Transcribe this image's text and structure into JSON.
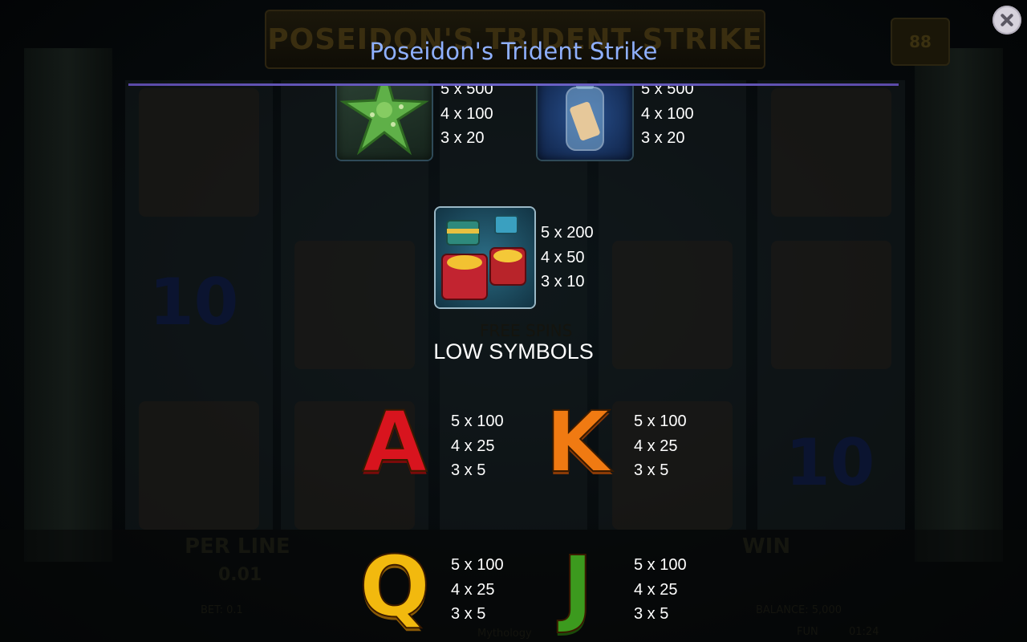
{
  "background": {
    "game_title": "POSEIDON'S TRIDENT STRIKE",
    "badge": "88",
    "per_line_label": "PER LINE",
    "per_line_value": "0.01",
    "win_label": "WIN",
    "bet_text": "BET: 0.1",
    "balance_text": "BALANCE: 5,000",
    "fun_label": "FUN",
    "clock": "01:24",
    "free_spins_text": "FREE SPINS",
    "ten_symbol": "10",
    "footer_brand": "Mythology"
  },
  "paytable": {
    "title": "Poseidon's Trident Strike",
    "close_icon": "close-icon",
    "high_symbols": [
      {
        "icon": "starfish-icon",
        "payouts": [
          "5 x 500",
          "4 x 100",
          "3 x 20"
        ]
      },
      {
        "icon": "message-bottle-icon",
        "payouts": [
          "5 x 500",
          "4 x 100",
          "3 x 20"
        ]
      },
      {
        "icon": "treasure-chests-icon",
        "payouts": [
          "5 x 200",
          "4 x 50",
          "3 x 10"
        ]
      }
    ],
    "low_heading": "LOW SYMBOLS",
    "low_symbols": [
      {
        "letter": "A",
        "color": "#d8141e",
        "payouts": [
          "5 x 100",
          "4 x 25",
          "3 x 5"
        ]
      },
      {
        "letter": "K",
        "color": "#f07a12",
        "payouts": [
          "5 x 100",
          "4 x 25",
          "3 x 5"
        ]
      },
      {
        "letter": "Q",
        "color": "#f2b90e",
        "payouts": [
          "5 x 100",
          "4 x 25",
          "3 x 5"
        ]
      },
      {
        "letter": "J",
        "color": "#3c9a1e",
        "payouts": [
          "5 x 100",
          "4 x 25",
          "3 x 5"
        ]
      }
    ]
  },
  "colors": {
    "title": "#8fb0ff",
    "rule": "#6c63c8",
    "text": "#ffffff"
  }
}
